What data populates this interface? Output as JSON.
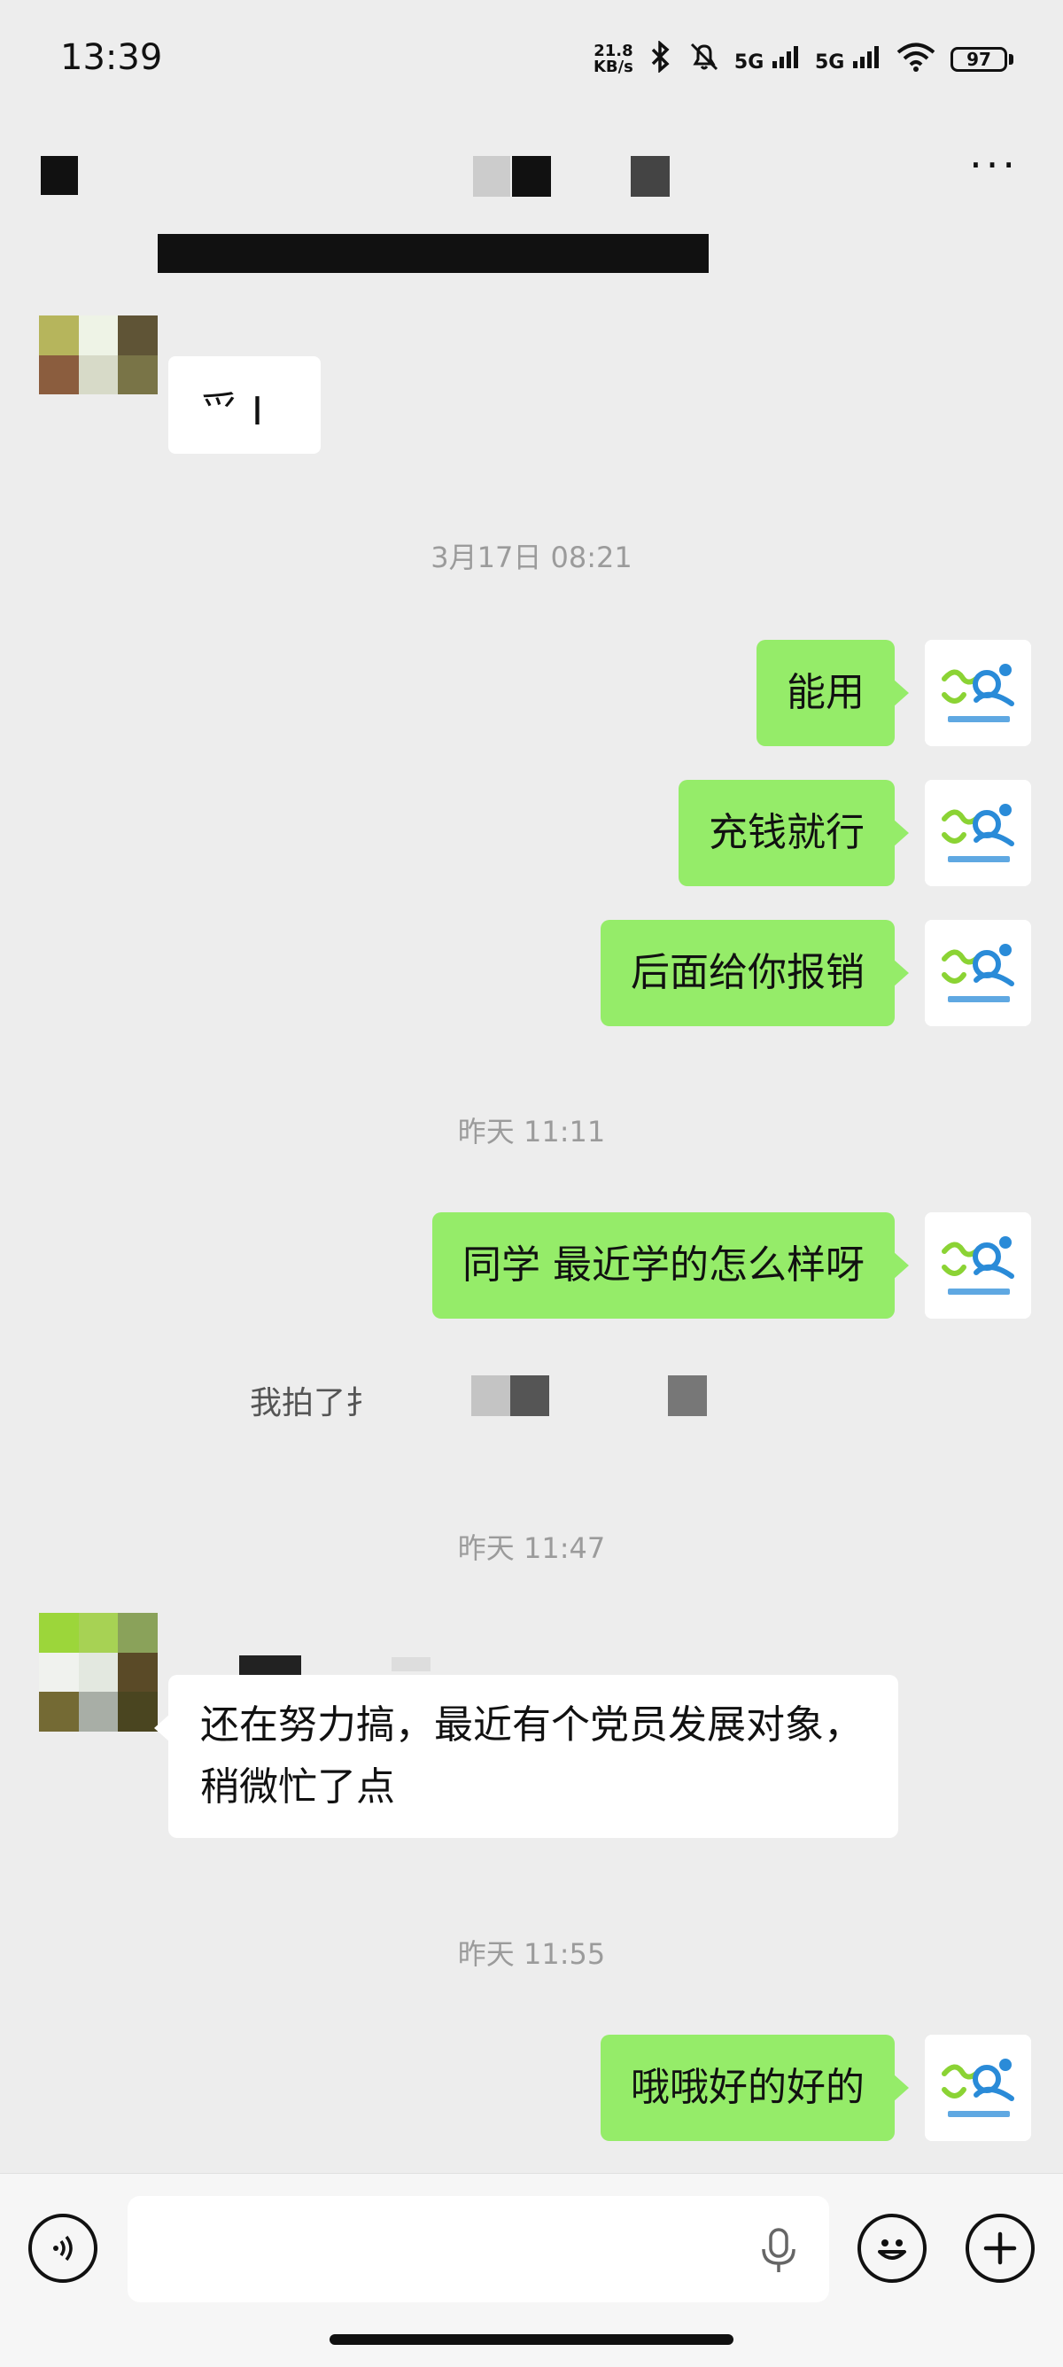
{
  "status_bar": {
    "time": "13:39",
    "net_speed_value": "21.8",
    "net_speed_unit": "KB/s",
    "signal_1": "5G",
    "signal_2": "5G",
    "battery": "97"
  },
  "colors": {
    "background": "#ededed",
    "sent_bubble": "#95ec69",
    "received_bubble": "#ffffff",
    "timestamp_text": "#9b9b9b"
  },
  "icons": {
    "more": "more-icon",
    "voice": "voice-icon",
    "mic": "mic-icon",
    "emoji": "emoji-icon",
    "plus": "plus-icon",
    "bluetooth": "bluetooth-icon",
    "mute": "mute-icon",
    "wifi": "wifi-icon"
  },
  "messages": {
    "m0_partial": "爫 I",
    "ts1": "3月17日 08:21",
    "m1": "能用",
    "m2": "充钱就行",
    "m3": "后面给你报销",
    "ts2": "昨天 11:11",
    "m4": "同学 最近学的怎么样呀",
    "pat": "我拍了扌",
    "ts3": "昨天 11:47",
    "m5": "还在努力搞，最近有个党员发展对象，稍微忙了点",
    "ts4": "昨天 11:55",
    "m6": "哦哦好的好的"
  },
  "input": {
    "placeholder": ""
  }
}
